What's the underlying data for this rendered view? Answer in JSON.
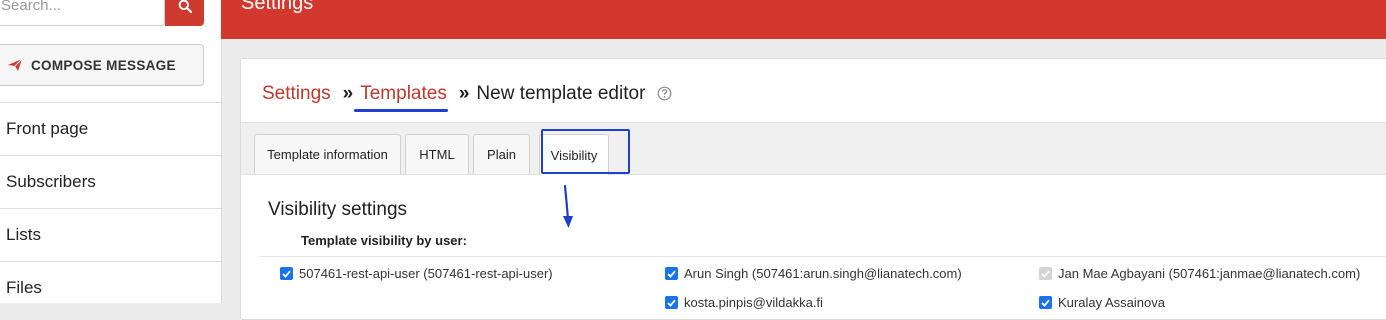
{
  "sidebar": {
    "search": {
      "placeholder": "Search..."
    },
    "compose_label": "COMPOSE MESSAGE",
    "nav_items": [
      {
        "label": "Front page"
      },
      {
        "label": "Subscribers"
      },
      {
        "label": "Lists"
      },
      {
        "label": "Files"
      }
    ]
  },
  "topbar": {
    "title": "Settings"
  },
  "breadcrumb": {
    "settings": "Settings",
    "templates": "Templates",
    "current": "New template editor",
    "separator": "»"
  },
  "tabs": [
    {
      "label": "Template information",
      "active": false
    },
    {
      "label": "HTML",
      "active": false
    },
    {
      "label": "Plain",
      "active": false
    },
    {
      "label": "Visibility",
      "active": true
    }
  ],
  "visibility": {
    "title": "Visibility settings",
    "subtitle": "Template visibility by user:",
    "users": [
      {
        "label": "507461-rest-api-user (507461-rest-api-user)",
        "checked": true,
        "disabled": false
      },
      {
        "label": "Arun Singh (507461:arun.singh@lianatech.com)",
        "checked": true,
        "disabled": false
      },
      {
        "label": "Jan Mae Agbayani (507461:janmae@lianatech.com)",
        "checked": true,
        "disabled": true
      },
      {
        "label": "kosta.pinpis@vildakka.fi",
        "checked": true,
        "disabled": false
      },
      {
        "label": "Kuralay Assainova",
        "checked": true,
        "disabled": false
      }
    ]
  },
  "colors": {
    "brand_red": "#d2382e",
    "link_red": "#c0392b",
    "annotation_blue": "#1f3fd1",
    "checkbox_blue": "#1a73e8"
  }
}
